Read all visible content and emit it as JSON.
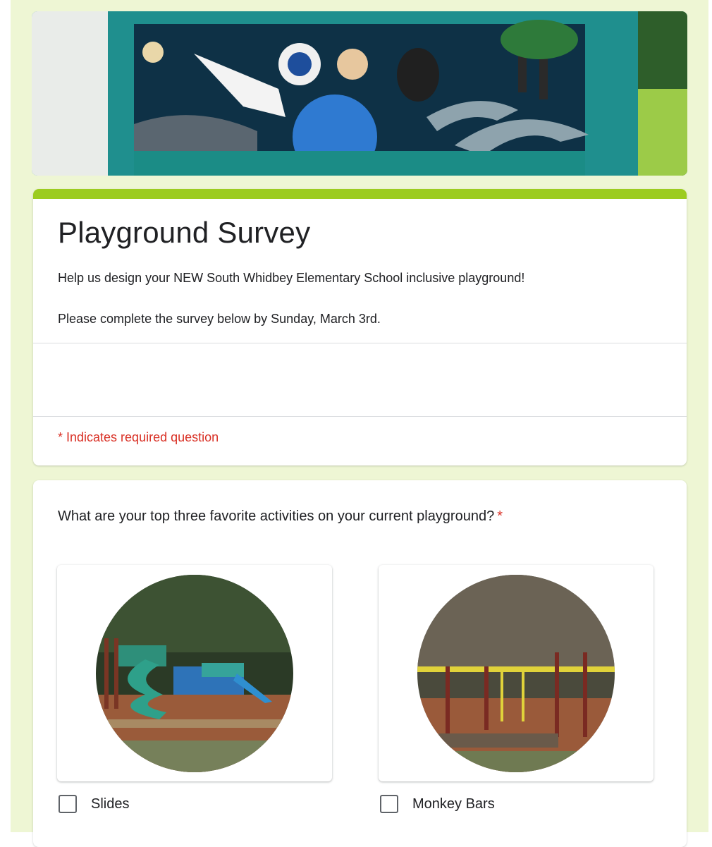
{
  "form": {
    "title": "Playground Survey",
    "description_line1": "Help us design your NEW South Whidbey Elementary School inclusive playground!",
    "description_line2": "Please complete the survey below by Sunday, March 3rd.",
    "required_note": "* Indicates required question"
  },
  "question": {
    "text": "What are your top three favorite activities on your current playground?",
    "required_mark": "*",
    "options": [
      {
        "label": "Slides",
        "checked": false
      },
      {
        "label": "Monkey Bars",
        "checked": false
      }
    ]
  },
  "colors": {
    "page_background": "#eef6d4",
    "accent": "#9ccc1f",
    "required": "#d93025"
  }
}
